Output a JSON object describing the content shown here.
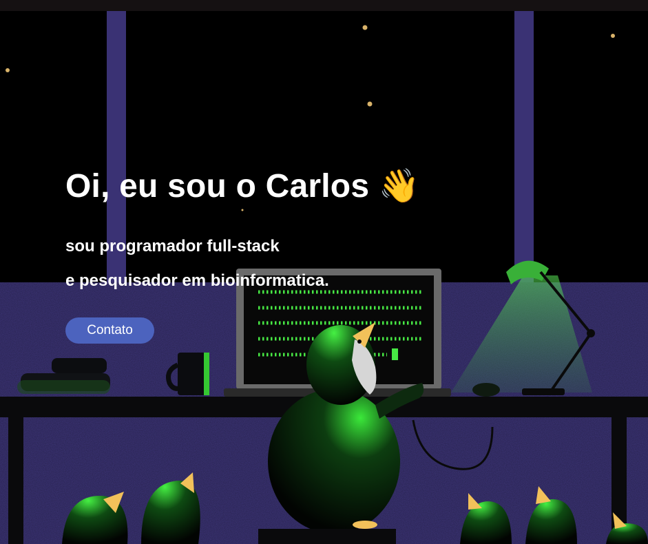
{
  "hero": {
    "greeting": "Oi, eu sou o Carlos",
    "wave_emoji": "👋",
    "line1": "sou programador full-stack",
    "line2": "e pesquisador em bioinformatica.",
    "contact_label": "Contato"
  },
  "colors": {
    "button": "#4c63be",
    "wall": "#3d3578",
    "code_green": "#4cf24a",
    "lamp_green": "#3fd43c",
    "beak": "#f2c15a"
  },
  "icons": [
    "wave-emoji",
    "penguin-illustration",
    "desk-lamp",
    "laptop",
    "coffee-mug",
    "book-stack"
  ]
}
